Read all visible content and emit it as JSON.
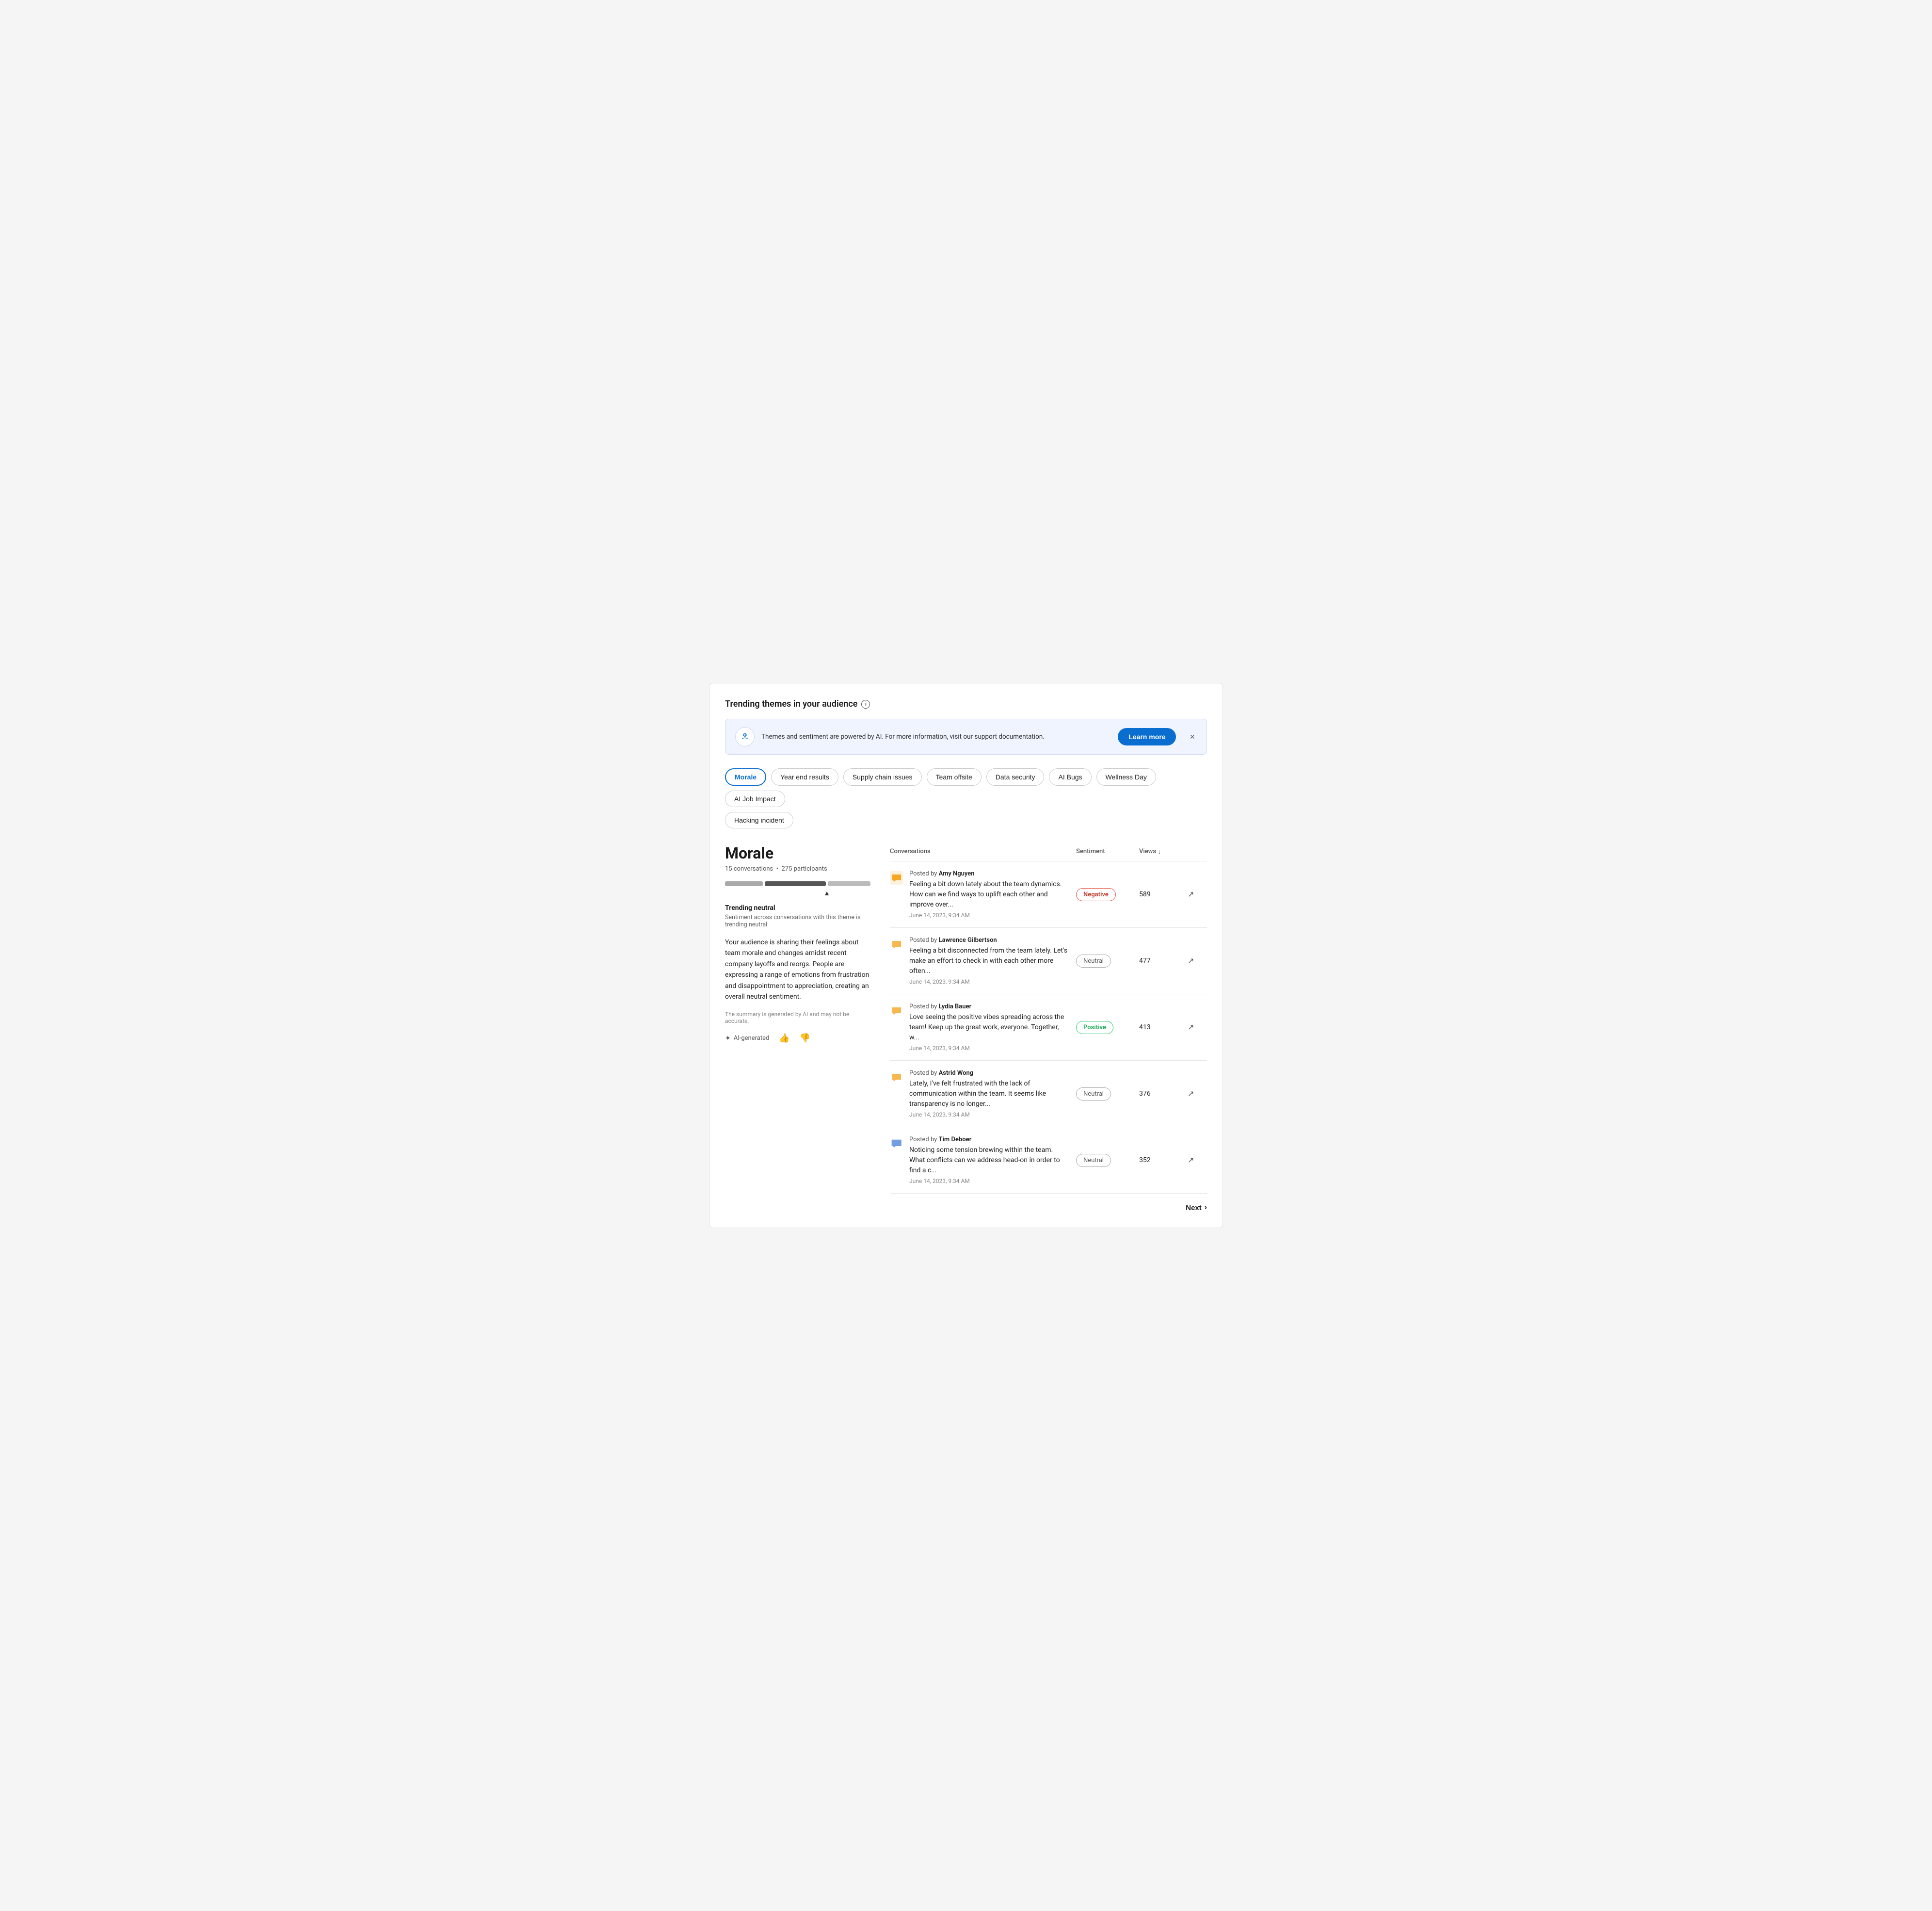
{
  "page": {
    "title": "Trending themes in your audience"
  },
  "banner": {
    "text": "Themes and sentiment are powered by AI. For more information, visit our support documentation.",
    "learn_more_label": "Learn more",
    "close_label": "×"
  },
  "tabs": {
    "row1": [
      {
        "label": "Morale",
        "active": true
      },
      {
        "label": "Year end results",
        "active": false
      },
      {
        "label": "Supply chain issues",
        "active": false
      },
      {
        "label": "Team offsite",
        "active": false
      },
      {
        "label": "Data security",
        "active": false
      },
      {
        "label": "AI Bugs",
        "active": false
      },
      {
        "label": "Wellness Day",
        "active": false
      },
      {
        "label": "AI Job Impact",
        "active": false
      }
    ],
    "row2": [
      {
        "label": "Hacking incident",
        "active": false
      }
    ]
  },
  "left_panel": {
    "theme_name": "Morale",
    "conversations_count": "15 conversations",
    "participants": "275 participants",
    "trending_label": "Trending neutral",
    "trending_sub": "Sentiment across conversations with this theme is trending neutral",
    "description": "Your audience is sharing their feelings about team morale and changes amidst recent company layoffs and reorgs. People are expressing a range of emotions from frustration and disappointment to appreciation, creating an overall neutral sentiment.",
    "disclaimer": "The summary is generated by AI and may not be accurate.",
    "ai_label": "AI-generated",
    "thumbs_up": "👍",
    "thumbs_down": "👎"
  },
  "table": {
    "headers": {
      "conversations": "Conversations",
      "sentiment": "Sentiment",
      "views": "Views",
      "sort_indicator": "↓"
    },
    "rows": [
      {
        "author": "Amy Nguyen",
        "text": "Feeling a bit down lately about the team dynamics. How can we find ways to uplift each other and improve over...",
        "date": "June 14, 2023, 9:34 AM",
        "sentiment": "Negative",
        "sentiment_type": "negative",
        "views": "589",
        "icon_color": "orange"
      },
      {
        "author": "Lawrence Gilbertson",
        "text": "Feeling a bit disconnected from the team lately. Let's make an effort to check in with each other more often...",
        "date": "June 14, 2023, 9:34 AM",
        "sentiment": "Neutral",
        "sentiment_type": "neutral",
        "views": "477",
        "icon_color": "orange"
      },
      {
        "author": "Lydia Bauer",
        "text": "Love seeing the positive vibes spreading across the team! Keep up the great work, everyone. Together, w...",
        "date": "June 14, 2023, 9:34 AM",
        "sentiment": "Positive",
        "sentiment_type": "positive",
        "views": "413",
        "icon_color": "orange"
      },
      {
        "author": "Astrid Wong",
        "text": "Lately, I've felt frustrated with the lack of communication within the team. It seems like transparency is no longer...",
        "date": "June 14, 2023, 9:34 AM",
        "sentiment": "Neutral",
        "sentiment_type": "neutral",
        "views": "376",
        "icon_color": "orange"
      },
      {
        "author": "Tim Deboer",
        "text": "Noticing some tension brewing within the team. What conflicts can we address head-on in order to find a c...",
        "date": "June 14, 2023, 9:34 AM",
        "sentiment": "Neutral",
        "sentiment_type": "neutral",
        "views": "352",
        "icon_color": "blue"
      }
    ]
  },
  "pagination": {
    "next_label": "Next"
  }
}
